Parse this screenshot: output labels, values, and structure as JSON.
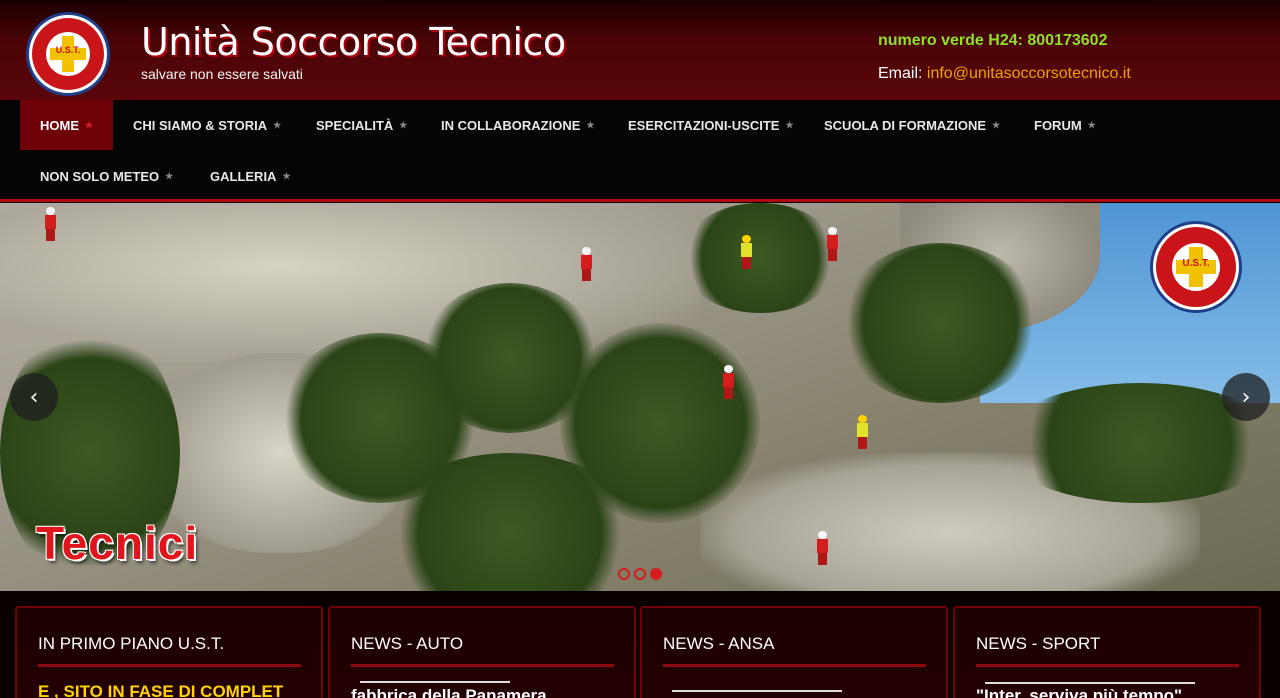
{
  "header": {
    "title": "Unità Soccorso Tecnico",
    "tagline": "salvare non essere salvati",
    "hotline": "numero verde H24: 800173602",
    "email_label": "Email:",
    "email_value": "info@unitasoccorsotecnico.it",
    "logo_text": "U.S.T."
  },
  "nav": {
    "items": [
      {
        "label": "HOME"
      },
      {
        "label": "CHI SIAMO & STORIA"
      },
      {
        "label": "SPECIALITÀ"
      },
      {
        "label": "IN COLLABORAZIONE"
      },
      {
        "label": "ESERCITAZIONI-USCITE"
      },
      {
        "label": "SCUOLA DI FORMAZIONE"
      },
      {
        "label": "FORUM"
      },
      {
        "label": "NON SOLO METEO"
      },
      {
        "label": "GALLERIA"
      }
    ],
    "active_index": 0
  },
  "hero": {
    "caption": "Tecnici",
    "emblem_text": "U.S.T.",
    "prev_icon": "‹",
    "next_icon": "›",
    "slide_count": 3,
    "active_slide": 3
  },
  "boxes": [
    {
      "title": "IN PRIMO PIANO U.S.T.",
      "text": "E , SITO IN FASE DI COMPLET"
    },
    {
      "title": "NEWS - AUTO",
      "text": "fabbrica della Panamera"
    },
    {
      "title": "NEWS - ANSA",
      "text": ""
    },
    {
      "title": "NEWS - SPORT",
      "text": "\"Inter, serviva più tempo\""
    }
  ],
  "colors": {
    "brand_red": "#6e0208",
    "accent_red": "#e0161c",
    "hotline_green": "#8fe029",
    "email_orange": "#f0a000",
    "ticker_yellow": "#ffd400"
  }
}
